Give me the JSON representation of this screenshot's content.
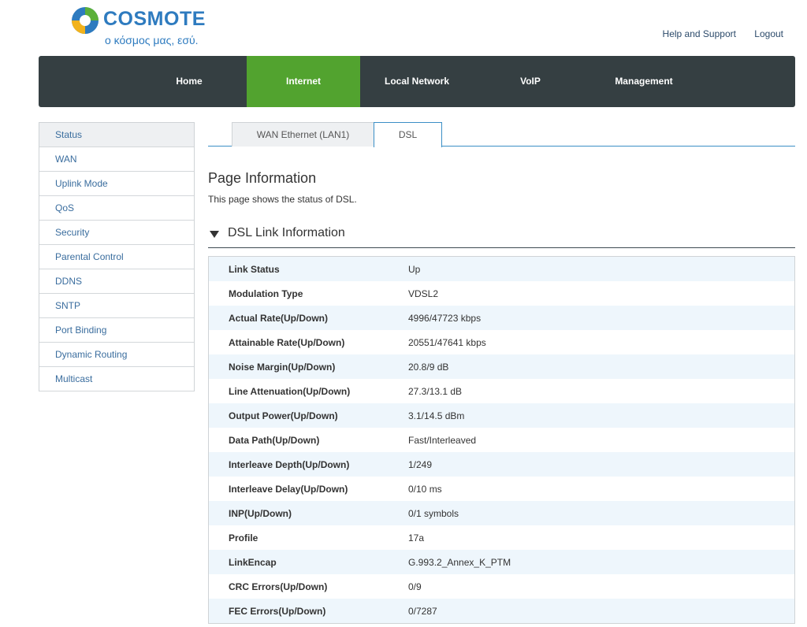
{
  "brand": {
    "name": "COSMOTE",
    "tagline": "ο κόσμος μας, εσύ."
  },
  "top_links": {
    "help": "Help and Support",
    "logout": "Logout"
  },
  "nav": {
    "items": [
      {
        "label": "Home",
        "active": false
      },
      {
        "label": "Internet",
        "active": true
      },
      {
        "label": "Local Network",
        "active": false
      },
      {
        "label": "VoIP",
        "active": false
      },
      {
        "label": "Management",
        "active": false
      }
    ]
  },
  "sidebar": {
    "items": [
      {
        "label": "Status",
        "active": true
      },
      {
        "label": "WAN"
      },
      {
        "label": "Uplink Mode"
      },
      {
        "label": "QoS"
      },
      {
        "label": "Security"
      },
      {
        "label": "Parental Control"
      },
      {
        "label": "DDNS"
      },
      {
        "label": "SNTP"
      },
      {
        "label": "Port Binding"
      },
      {
        "label": "Dynamic Routing"
      },
      {
        "label": "Multicast"
      }
    ]
  },
  "tabs": {
    "wan_ethernet": "WAN Ethernet (LAN1)",
    "dsl": "DSL"
  },
  "page": {
    "title": "Page Information",
    "description": "This page shows the status of DSL."
  },
  "section": {
    "title": "DSL Link Information"
  },
  "dsl_info": [
    {
      "label": "Link Status",
      "value": "Up"
    },
    {
      "label": "Modulation Type",
      "value": "VDSL2"
    },
    {
      "label": "Actual Rate(Up/Down)",
      "value": "4996/47723 kbps"
    },
    {
      "label": "Attainable Rate(Up/Down)",
      "value": "20551/47641 kbps"
    },
    {
      "label": "Noise Margin(Up/Down)",
      "value": "20.8/9 dB"
    },
    {
      "label": "Line Attenuation(Up/Down)",
      "value": "27.3/13.1 dB"
    },
    {
      "label": "Output Power(Up/Down)",
      "value": "3.1/14.5 dBm"
    },
    {
      "label": "Data Path(Up/Down)",
      "value": "Fast/Interleaved"
    },
    {
      "label": "Interleave Depth(Up/Down)",
      "value": "1/249"
    },
    {
      "label": "Interleave Delay(Up/Down)",
      "value": "0/10 ms"
    },
    {
      "label": "INP(Up/Down)",
      "value": "0/1 symbols"
    },
    {
      "label": "Profile",
      "value": "17a"
    },
    {
      "label": "LinkEncap",
      "value": "G.993.2_Annex_K_PTM"
    },
    {
      "label": "CRC Errors(Up/Down)",
      "value": "0/9"
    },
    {
      "label": "FEC Errors(Up/Down)",
      "value": "0/7287"
    }
  ],
  "colors": {
    "nav_bg": "#353f42",
    "nav_active": "#52a32f",
    "brand_blue": "#2e7bbf",
    "tab_accent": "#3b8fc6"
  }
}
